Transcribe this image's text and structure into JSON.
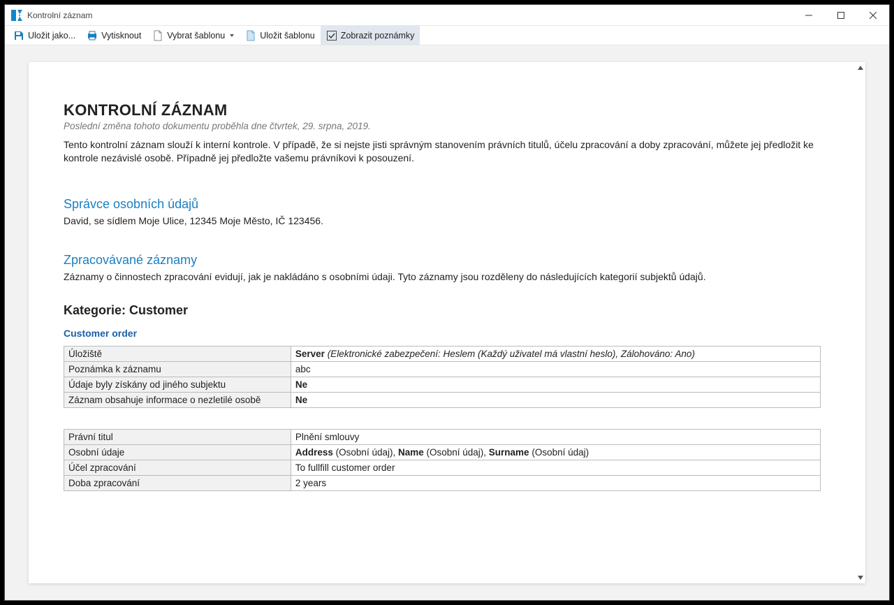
{
  "window": {
    "title": "Kontrolní záznam"
  },
  "toolbar": {
    "save_as": "Uložit jako...",
    "print": "Vytisknout",
    "choose_template": "Vybrat šablonu",
    "save_template": "Uložit šablonu",
    "show_notes": "Zobrazit poznámky"
  },
  "doc": {
    "title": "KONTROLNÍ ZÁZNAM",
    "last_change": "Poslední změna tohoto dokumentu proběhla dne čtvrtek, 29. srpna, 2019.",
    "intro": "Tento kontrolní záznam slouží k interní kontrole. V případě, že si nejste jisti správným stanovením právních titulů, účelu zpracování a doby zpracování, můžete jej předložit ke kontrole nezávislé osobě. Případně jej předložte vašemu právníkovi k posouzení.",
    "controller_heading": "Správce osobních údajů",
    "controller_text": "David, se sídlem Moje Ulice, 12345 Moje Město, IČ 123456.",
    "records_heading": "Zpracovávané záznamy",
    "records_text": "Záznamy o činnostech zpracování evidují, jak je nakládáno s osobními údaji. Tyto záznamy jsou rozděleny do následujících kategorií subjektů údajů.",
    "category_label": "Kategorie: Customer",
    "record_name": "Customer order",
    "table1": {
      "r1_label": "Úložiště",
      "r1_val_bold": "Server ",
      "r1_val_italic": "(Elektronické zabezpečení: Heslem (Každý uživatel má vlastní heslo), Zálohováno: Ano)",
      "r2_label": "Poznámka k záznamu",
      "r2_val": "abc",
      "r3_label": "Údaje byly získány od jiného subjektu",
      "r3_val": "Ne",
      "r4_label": "Záznam obsahuje informace o nezletilé osobě",
      "r4_val": "Ne"
    },
    "table2": {
      "r1_label": "Právní titul",
      "r1_val": "Plnění smlouvy",
      "r2_label": "Osobní údaje",
      "r2_b1": "Address",
      "r2_p1": " (Osobní údaj), ",
      "r2_b2": "Name",
      "r2_p2": " (Osobní údaj), ",
      "r2_b3": "Surname",
      "r2_p3": " (Osobní údaj)",
      "r3_label": "Účel zpracování",
      "r3_val": "To fullfill customer order",
      "r4_label": "Doba zpracování",
      "r4_val": "2 years"
    }
  }
}
